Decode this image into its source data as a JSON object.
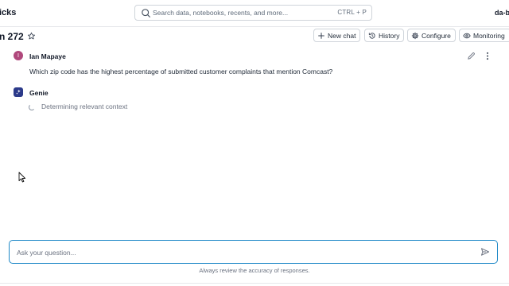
{
  "header": {
    "app_name": "icks",
    "search_placeholder": "Search data, notebooks, recents, and more...",
    "search_shortcut": "CTRL + P",
    "workspace": "da-be"
  },
  "title_row": {
    "title": "n 272",
    "buttons": {
      "new_chat": "New chat",
      "history": "History",
      "configure": "Configure",
      "monitoring": "Monitoring"
    }
  },
  "conversation": {
    "user": {
      "initial": "I",
      "name": "Ian Mapaye",
      "message": "Which zip code has the highest percentage of submitted customer complaints that mention Comcast?"
    },
    "assistant": {
      "name": "Genie",
      "status": "Determining relevant context"
    }
  },
  "composer": {
    "placeholder": "Ask your question...",
    "disclaimer": "Always review the accuracy of responses."
  },
  "colors": {
    "user_avatar": "#b0487c",
    "genie_avatar": "#2c3a8a",
    "input_border": "#1e88c7"
  }
}
